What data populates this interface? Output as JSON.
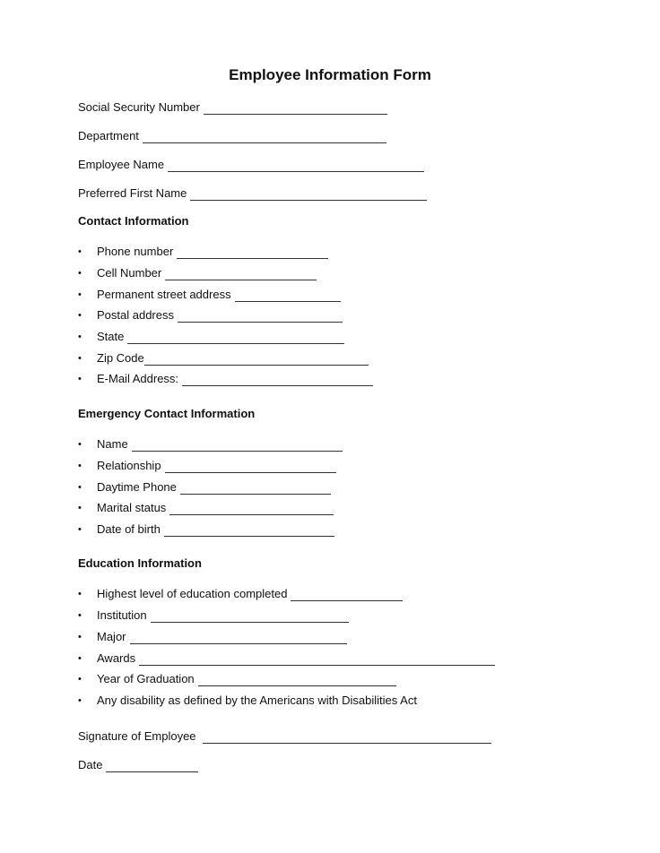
{
  "title": "Employee Information Form",
  "top_fields": [
    {
      "label": "Social Security Number"
    },
    {
      "label": "Department"
    },
    {
      "label": "Employee Name"
    },
    {
      "label": "Preferred First Name"
    }
  ],
  "bullet_glyph": "•",
  "sections": [
    {
      "heading": "Contact Information",
      "items": [
        {
          "label": "Phone number"
        },
        {
          "label": "Cell Number"
        },
        {
          "label": "Permanent street address"
        },
        {
          "label": "Postal address"
        },
        {
          "label": "State"
        },
        {
          "label": "Zip Code"
        },
        {
          "label": "E-Mail Address:"
        }
      ]
    },
    {
      "heading": "Emergency Contact Information",
      "items": [
        {
          "label": "Name"
        },
        {
          "label": "Relationship"
        },
        {
          "label": "Daytime Phone"
        },
        {
          "label": "Marital status"
        },
        {
          "label": "Date of birth"
        }
      ]
    },
    {
      "heading": "Education Information",
      "items": [
        {
          "label": "Highest level of education completed"
        },
        {
          "label": "Institution"
        },
        {
          "label": "Major"
        },
        {
          "label": "Awards"
        },
        {
          "label": "Year of Graduation"
        },
        {
          "label": "Any disability as defined by the Americans with Disabilities Act"
        }
      ]
    }
  ],
  "footer_fields": [
    {
      "label": "Signature of Employee"
    },
    {
      "label": "Date"
    }
  ]
}
